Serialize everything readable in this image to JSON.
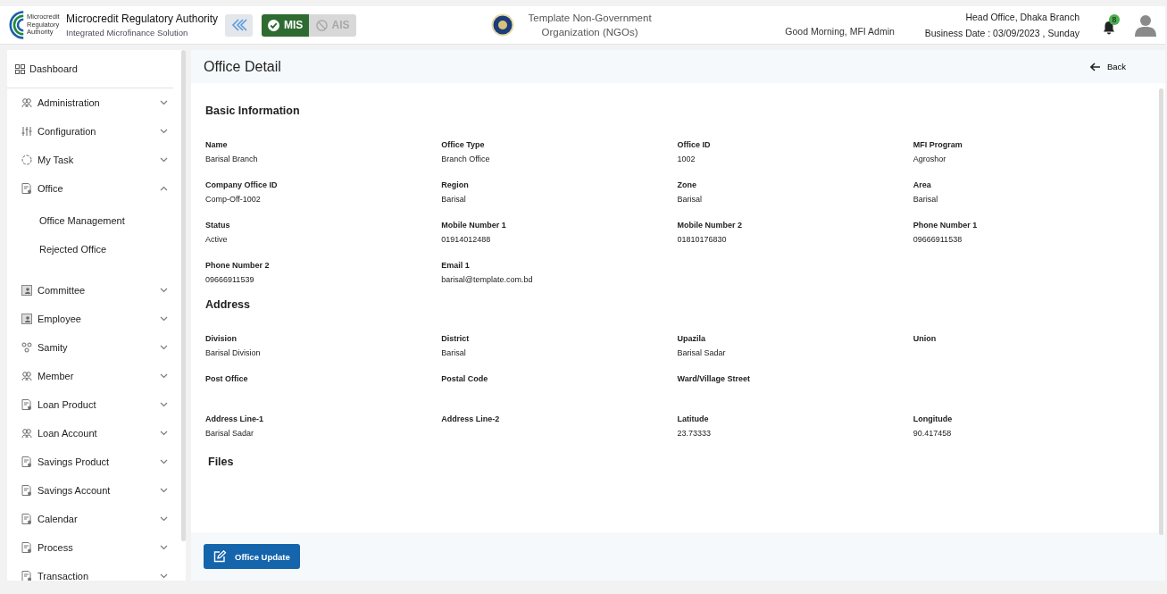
{
  "header": {
    "org_name": "Microcredit Regulatory Authority",
    "org_sub": "Integrated Microfinance Solution",
    "logo_text": "Microcredit Regulatory Authority",
    "modules": [
      {
        "label": "MIS",
        "selected": true
      },
      {
        "label": "AIS",
        "selected": false
      }
    ],
    "ngo_name": "Template Non-Government Organization (NGOs)",
    "greeting": "Good Morning, MFI Admin",
    "branch": "Head Office, Dhaka Branch",
    "business_date": "Business Date : 03/09/2023 , Sunday",
    "notifications": "8"
  },
  "sidebar": {
    "dashboard": "Dashboard",
    "items": [
      {
        "label": "Administration",
        "expanded": false
      },
      {
        "label": "Configuration",
        "expanded": false
      },
      {
        "label": "My Task",
        "expanded": false
      },
      {
        "label": "Office",
        "expanded": true,
        "children": [
          {
            "label": "Office Management"
          },
          {
            "label": "Rejected Office"
          }
        ]
      },
      {
        "label": "Committee",
        "expanded": false
      },
      {
        "label": "Employee",
        "expanded": false
      },
      {
        "label": "Samity",
        "expanded": false
      },
      {
        "label": "Member",
        "expanded": false
      },
      {
        "label": "Loan Product",
        "expanded": false
      },
      {
        "label": "Loan Account",
        "expanded": false
      },
      {
        "label": "Savings Product",
        "expanded": false
      },
      {
        "label": "Savings Account",
        "expanded": false
      },
      {
        "label": "Calendar",
        "expanded": false
      },
      {
        "label": "Process",
        "expanded": false
      },
      {
        "label": "Transaction",
        "expanded": false
      }
    ]
  },
  "page": {
    "title": "Office Detail",
    "back": "Back",
    "sections": [
      {
        "title": "Basic Information",
        "rows": [
          [
            {
              "label": "Name",
              "value": "Barisal Branch"
            },
            {
              "label": "Office Type",
              "value": "Branch Office"
            },
            {
              "label": "Office ID",
              "value": "1002"
            },
            {
              "label": "MFI Program",
              "value": "Agroshor"
            }
          ],
          [
            {
              "label": "Company Office ID",
              "value": "Comp-Off-1002"
            },
            {
              "label": "Region",
              "value": "Barisal"
            },
            {
              "label": "Zone",
              "value": "Barisal"
            },
            {
              "label": "Area",
              "value": "Barisal"
            }
          ],
          [
            {
              "label": "Status",
              "value": "Active"
            },
            {
              "label": "Mobile Number 1",
              "value": "01914012488"
            },
            {
              "label": "Mobile Number 2",
              "value": "01810176830"
            },
            {
              "label": "Phone Number 1",
              "value": "09666911538"
            }
          ],
          [
            {
              "label": "Phone Number 2",
              "value": "09666911539"
            },
            {
              "label": "Email 1",
              "value": "barisal@template.com.bd"
            }
          ]
        ]
      },
      {
        "title": "Address",
        "rows": [
          [
            {
              "label": "Division",
              "value": "Barisal Division"
            },
            {
              "label": "District",
              "value": "Barisal"
            },
            {
              "label": "Upazila",
              "value": "Barisal Sadar"
            },
            {
              "label": "Union"
            }
          ],
          [
            {
              "label": "Post Office"
            },
            {
              "label": "Postal Code"
            },
            {
              "label": "Ward/Village Street"
            }
          ],
          [
            {
              "label": "Address Line-1",
              "value": "Barisal Sadar"
            },
            {
              "label": "Address Line-2"
            },
            {
              "label": "Latitude",
              "value": "23.73333"
            },
            {
              "label": "Longitude",
              "value": "90.417458"
            }
          ]
        ]
      },
      {
        "title": "Files"
      }
    ],
    "update_button": "Office Update"
  }
}
